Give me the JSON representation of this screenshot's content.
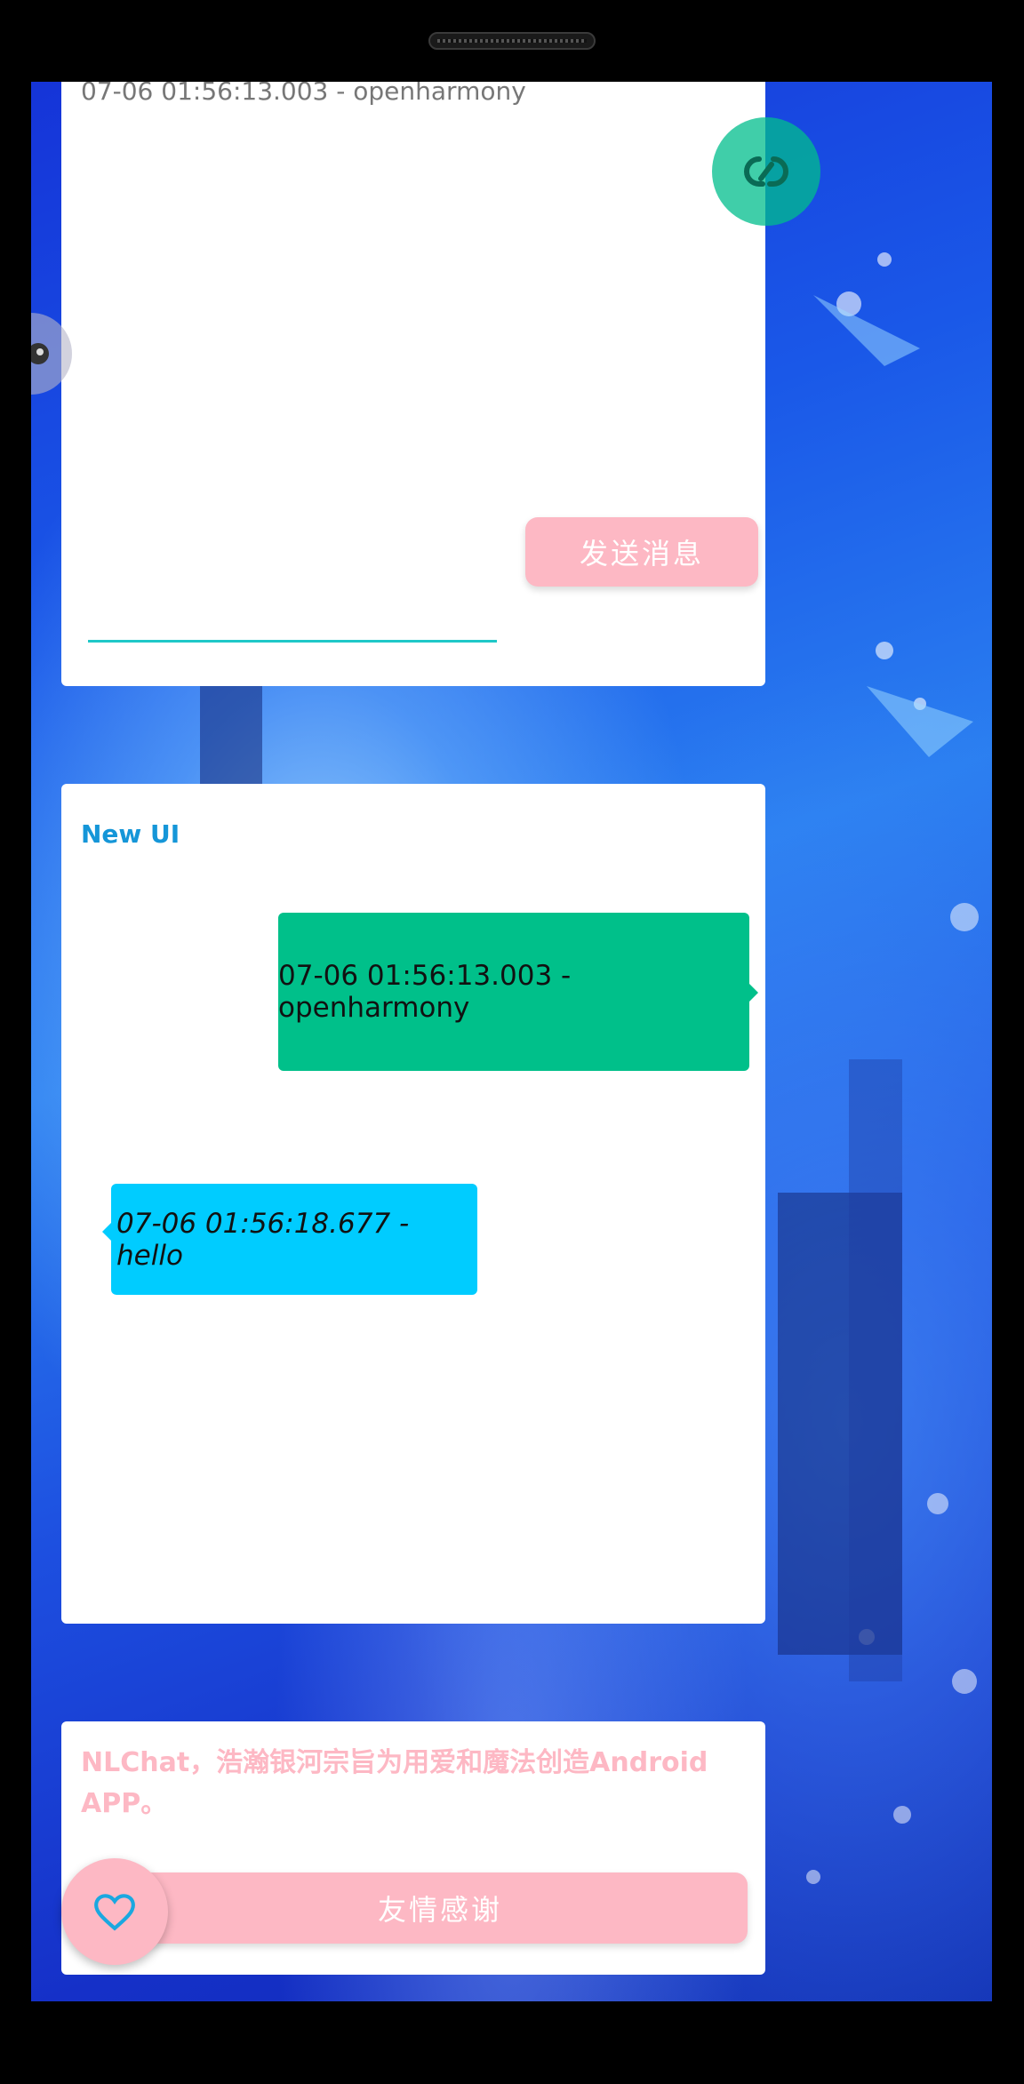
{
  "log": {
    "latest": "07-06 01:56:13.003 - openharmony"
  },
  "composer": {
    "send_label": "发送消息"
  },
  "chat": {
    "title": "New UI",
    "messages": [
      {
        "text": "07-06 01:56:13.003 - openharmony",
        "side": "right"
      },
      {
        "text": "07-06 01:56:18.677 - hello",
        "side": "left"
      }
    ]
  },
  "about": {
    "description": "NLChat，浩瀚银河宗旨为用爱和魔法创造Android APP。",
    "thanks_label": "友情感谢"
  },
  "icons": {
    "float_ball": "link-icon",
    "side_ball": "avatar-icon",
    "fab": "heart-icon"
  },
  "colors": {
    "pink": "#fdb8c4",
    "teal": "#00c08a",
    "cyan": "#00ccff",
    "title_blue": "#1596d8",
    "input_line": "#1fc8c8"
  }
}
